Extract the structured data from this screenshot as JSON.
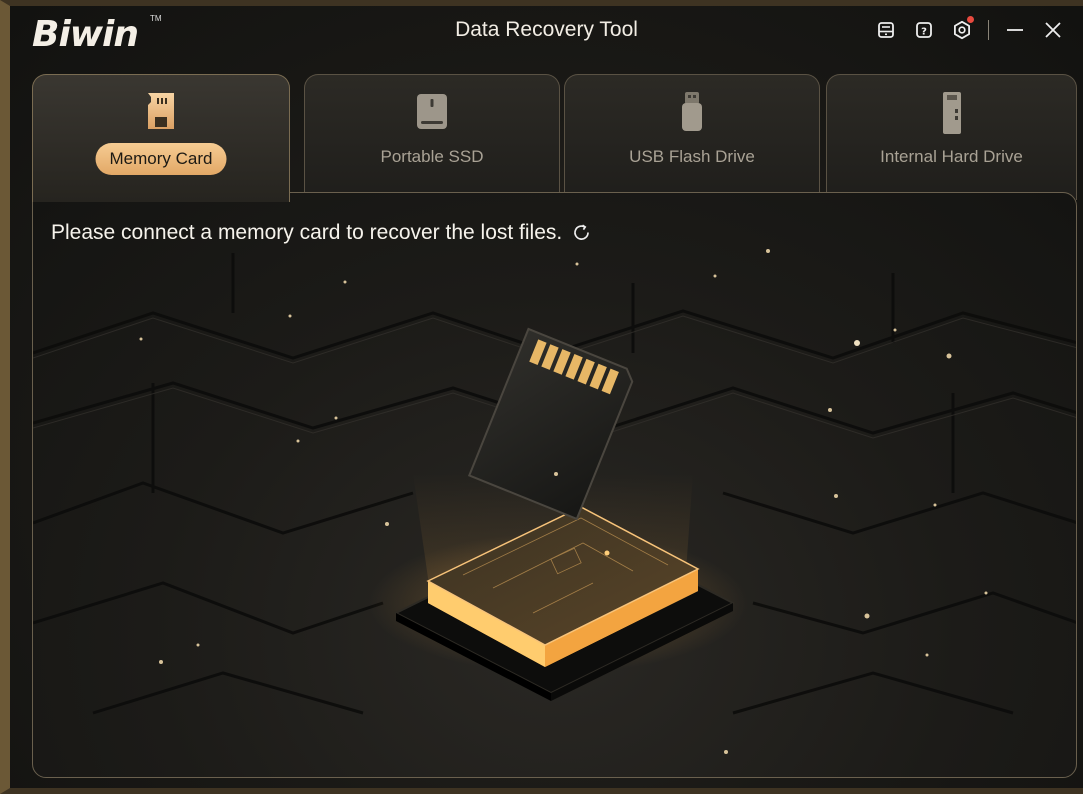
{
  "app": {
    "logo": "Biwin",
    "logo_tm": "TM",
    "title": "Data Recovery Tool"
  },
  "titlebar_icons": [
    "save-log-icon",
    "help-icon",
    "settings-icon",
    "minimize-icon",
    "close-icon"
  ],
  "tabs": [
    {
      "label": "Memory Card",
      "icon": "memory-card-icon",
      "active": true
    },
    {
      "label": "Portable SSD",
      "icon": "portable-ssd-icon",
      "active": false
    },
    {
      "label": "USB Flash Drive",
      "icon": "usb-flash-drive-icon",
      "active": false
    },
    {
      "label": "Internal Hard Drive",
      "icon": "internal-hard-drive-icon",
      "active": false
    }
  ],
  "content": {
    "message": "Please connect a memory card to recover the lost files."
  },
  "colors": {
    "accent": "#f0be82",
    "accent_dark": "#e2a866",
    "chip_glow": "#ffb44a",
    "notification": "#e84a3f"
  }
}
